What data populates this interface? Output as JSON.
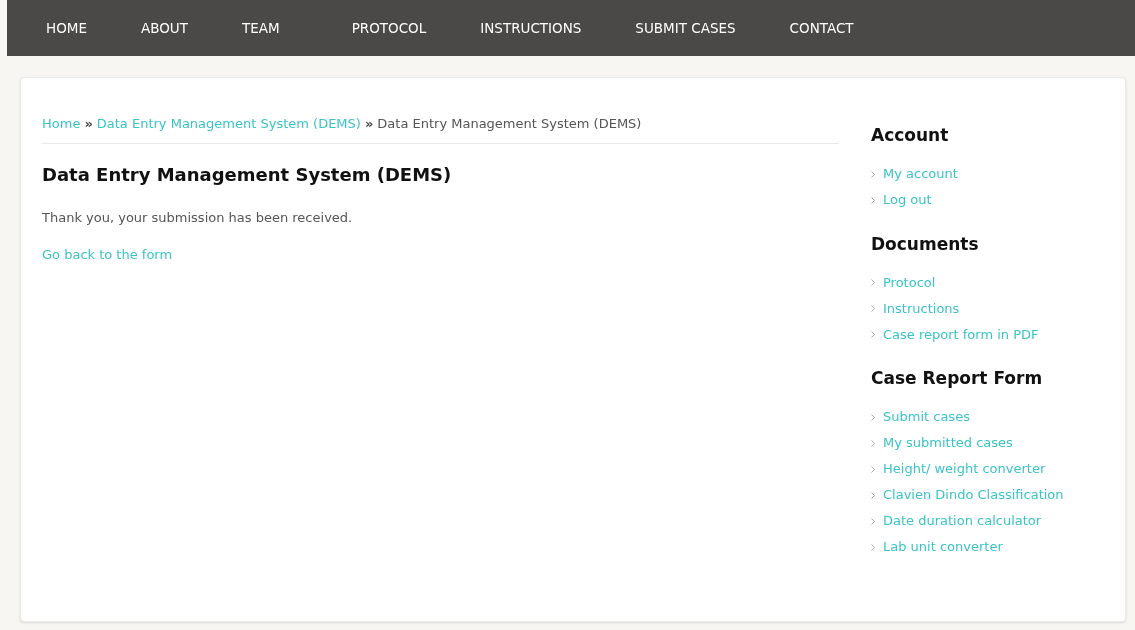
{
  "nav": [
    {
      "label": "HOME"
    },
    {
      "label": "ABOUT"
    },
    {
      "label": "TEAM"
    },
    {
      "label": "PROTOCOL"
    },
    {
      "label": "INSTRUCTIONS"
    },
    {
      "label": "SUBMIT CASES"
    },
    {
      "label": "CONTACT"
    }
  ],
  "breadcrumb": [
    {
      "kind": "link",
      "text": "Home"
    },
    {
      "kind": "separator",
      "text": "»"
    },
    {
      "kind": "link",
      "text": "Data Entry Management System (DEMS)"
    },
    {
      "kind": "separator",
      "text": "»"
    },
    {
      "kind": "current",
      "text": "Data Entry Management System (DEMS)"
    }
  ],
  "title": "Data Entry Management System (DEMS)",
  "message": "Thank you, your submission has been received.",
  "back_link": "Go back to the form",
  "sidebar": [
    {
      "heading": "Account",
      "links": [
        "My account",
        "Log out"
      ]
    },
    {
      "heading": "Documents",
      "links": [
        "Protocol",
        "Instructions",
        "Case report form in PDF"
      ]
    },
    {
      "heading": "Case Report Form",
      "links": [
        "Submit cases",
        "My submitted cases",
        "Height/ weight converter",
        "Clavien Dindo Classification",
        "Date duration calculator",
        "Lab unit converter"
      ]
    }
  ]
}
